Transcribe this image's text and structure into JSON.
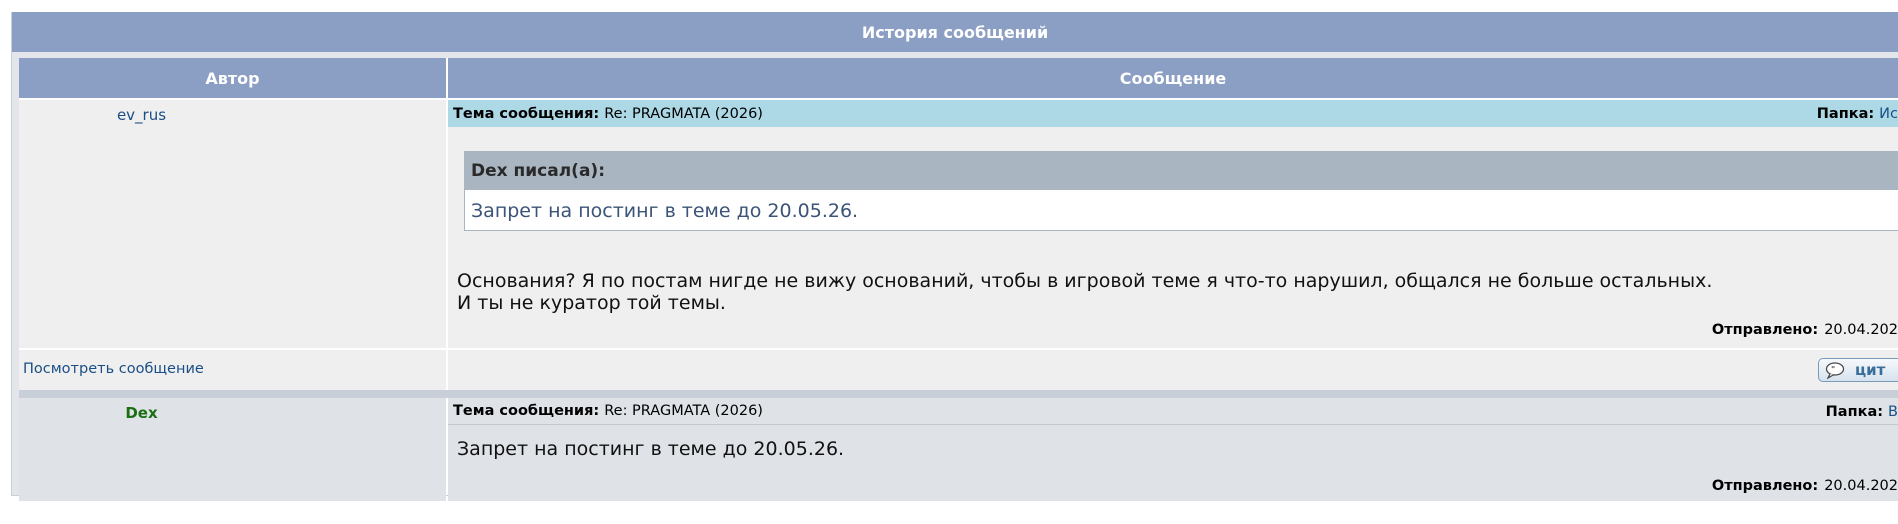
{
  "header": {
    "title": "История сообщений"
  },
  "columns": {
    "author": "Автор",
    "message": "Сообщение"
  },
  "posts": [
    {
      "author": "ev_rus",
      "subject_label": "Тема сообщения:",
      "subject": "Re: PRAGMATA (2026)",
      "folder_label": "Папка:",
      "folder": "Ис",
      "quote": {
        "author": "Dex писал(а):",
        "text": "Запрет на постинг в теме до 20.05.26."
      },
      "body_lines": [
        "Основания? Я по постам нигде не вижу оснований, чтобы в игровой теме я что-то нарушил, общался не больше остальных.",
        "И ты не куратор той темы."
      ],
      "sent_label": "Отправлено:",
      "sent": "20.04.202",
      "view_link": "Посмотреть сообщение",
      "quote_button": "цит"
    },
    {
      "author": "Dex",
      "subject_label": "Тема сообщения:",
      "subject": "Re: PRAGMATA (2026)",
      "folder_label": "Папка:",
      "folder": "В",
      "body_lines": [
        "Запрет на постинг в теме до 20.05.26."
      ],
      "sent_label": "Отправлено:",
      "sent": "20.04.202"
    }
  ],
  "icons": {
    "quote_button_icon": "speech-bubble-icon"
  },
  "colors": {
    "header_bg": "#8b9ec4",
    "subject_bar": "#add8e6",
    "quote_head": "#a9b5c1",
    "link": "#1a4f85",
    "author_green": "#1b6e13"
  }
}
